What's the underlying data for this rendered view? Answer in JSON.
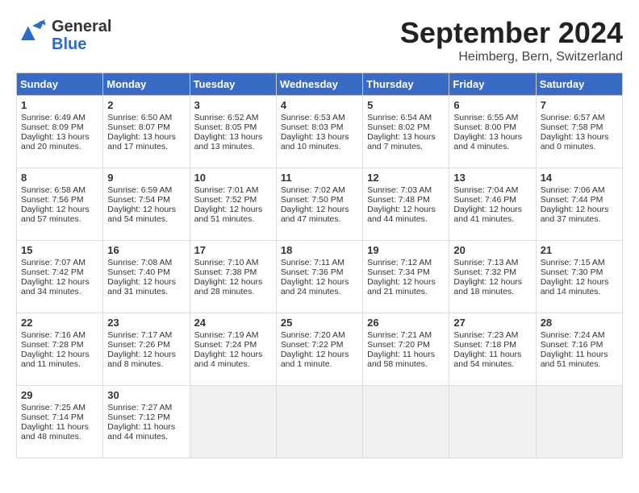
{
  "header": {
    "logo_general": "General",
    "logo_blue": "Blue",
    "month": "September 2024",
    "location": "Heimberg, Bern, Switzerland"
  },
  "columns": [
    "Sunday",
    "Monday",
    "Tuesday",
    "Wednesday",
    "Thursday",
    "Friday",
    "Saturday"
  ],
  "weeks": [
    [
      {
        "day": "1",
        "lines": [
          "Sunrise: 6:49 AM",
          "Sunset: 8:09 PM",
          "Daylight: 13 hours",
          "and 20 minutes."
        ]
      },
      {
        "day": "2",
        "lines": [
          "Sunrise: 6:50 AM",
          "Sunset: 8:07 PM",
          "Daylight: 13 hours",
          "and 17 minutes."
        ]
      },
      {
        "day": "3",
        "lines": [
          "Sunrise: 6:52 AM",
          "Sunset: 8:05 PM",
          "Daylight: 13 hours",
          "and 13 minutes."
        ]
      },
      {
        "day": "4",
        "lines": [
          "Sunrise: 6:53 AM",
          "Sunset: 8:03 PM",
          "Daylight: 13 hours",
          "and 10 minutes."
        ]
      },
      {
        "day": "5",
        "lines": [
          "Sunrise: 6:54 AM",
          "Sunset: 8:02 PM",
          "Daylight: 13 hours",
          "and 7 minutes."
        ]
      },
      {
        "day": "6",
        "lines": [
          "Sunrise: 6:55 AM",
          "Sunset: 8:00 PM",
          "Daylight: 13 hours",
          "and 4 minutes."
        ]
      },
      {
        "day": "7",
        "lines": [
          "Sunrise: 6:57 AM",
          "Sunset: 7:58 PM",
          "Daylight: 13 hours",
          "and 0 minutes."
        ]
      }
    ],
    [
      {
        "day": "8",
        "lines": [
          "Sunrise: 6:58 AM",
          "Sunset: 7:56 PM",
          "Daylight: 12 hours",
          "and 57 minutes."
        ]
      },
      {
        "day": "9",
        "lines": [
          "Sunrise: 6:59 AM",
          "Sunset: 7:54 PM",
          "Daylight: 12 hours",
          "and 54 minutes."
        ]
      },
      {
        "day": "10",
        "lines": [
          "Sunrise: 7:01 AM",
          "Sunset: 7:52 PM",
          "Daylight: 12 hours",
          "and 51 minutes."
        ]
      },
      {
        "day": "11",
        "lines": [
          "Sunrise: 7:02 AM",
          "Sunset: 7:50 PM",
          "Daylight: 12 hours",
          "and 47 minutes."
        ]
      },
      {
        "day": "12",
        "lines": [
          "Sunrise: 7:03 AM",
          "Sunset: 7:48 PM",
          "Daylight: 12 hours",
          "and 44 minutes."
        ]
      },
      {
        "day": "13",
        "lines": [
          "Sunrise: 7:04 AM",
          "Sunset: 7:46 PM",
          "Daylight: 12 hours",
          "and 41 minutes."
        ]
      },
      {
        "day": "14",
        "lines": [
          "Sunrise: 7:06 AM",
          "Sunset: 7:44 PM",
          "Daylight: 12 hours",
          "and 37 minutes."
        ]
      }
    ],
    [
      {
        "day": "15",
        "lines": [
          "Sunrise: 7:07 AM",
          "Sunset: 7:42 PM",
          "Daylight: 12 hours",
          "and 34 minutes."
        ]
      },
      {
        "day": "16",
        "lines": [
          "Sunrise: 7:08 AM",
          "Sunset: 7:40 PM",
          "Daylight: 12 hours",
          "and 31 minutes."
        ]
      },
      {
        "day": "17",
        "lines": [
          "Sunrise: 7:10 AM",
          "Sunset: 7:38 PM",
          "Daylight: 12 hours",
          "and 28 minutes."
        ]
      },
      {
        "day": "18",
        "lines": [
          "Sunrise: 7:11 AM",
          "Sunset: 7:36 PM",
          "Daylight: 12 hours",
          "and 24 minutes."
        ]
      },
      {
        "day": "19",
        "lines": [
          "Sunrise: 7:12 AM",
          "Sunset: 7:34 PM",
          "Daylight: 12 hours",
          "and 21 minutes."
        ]
      },
      {
        "day": "20",
        "lines": [
          "Sunrise: 7:13 AM",
          "Sunset: 7:32 PM",
          "Daylight: 12 hours",
          "and 18 minutes."
        ]
      },
      {
        "day": "21",
        "lines": [
          "Sunrise: 7:15 AM",
          "Sunset: 7:30 PM",
          "Daylight: 12 hours",
          "and 14 minutes."
        ]
      }
    ],
    [
      {
        "day": "22",
        "lines": [
          "Sunrise: 7:16 AM",
          "Sunset: 7:28 PM",
          "Daylight: 12 hours",
          "and 11 minutes."
        ]
      },
      {
        "day": "23",
        "lines": [
          "Sunrise: 7:17 AM",
          "Sunset: 7:26 PM",
          "Daylight: 12 hours",
          "and 8 minutes."
        ]
      },
      {
        "day": "24",
        "lines": [
          "Sunrise: 7:19 AM",
          "Sunset: 7:24 PM",
          "Daylight: 12 hours",
          "and 4 minutes."
        ]
      },
      {
        "day": "25",
        "lines": [
          "Sunrise: 7:20 AM",
          "Sunset: 7:22 PM",
          "Daylight: 12 hours",
          "and 1 minute."
        ]
      },
      {
        "day": "26",
        "lines": [
          "Sunrise: 7:21 AM",
          "Sunset: 7:20 PM",
          "Daylight: 11 hours",
          "and 58 minutes."
        ]
      },
      {
        "day": "27",
        "lines": [
          "Sunrise: 7:23 AM",
          "Sunset: 7:18 PM",
          "Daylight: 11 hours",
          "and 54 minutes."
        ]
      },
      {
        "day": "28",
        "lines": [
          "Sunrise: 7:24 AM",
          "Sunset: 7:16 PM",
          "Daylight: 11 hours",
          "and 51 minutes."
        ]
      }
    ],
    [
      {
        "day": "29",
        "lines": [
          "Sunrise: 7:25 AM",
          "Sunset: 7:14 PM",
          "Daylight: 11 hours",
          "and 48 minutes."
        ]
      },
      {
        "day": "30",
        "lines": [
          "Sunrise: 7:27 AM",
          "Sunset: 7:12 PM",
          "Daylight: 11 hours",
          "and 44 minutes."
        ]
      },
      null,
      null,
      null,
      null,
      null
    ]
  ]
}
